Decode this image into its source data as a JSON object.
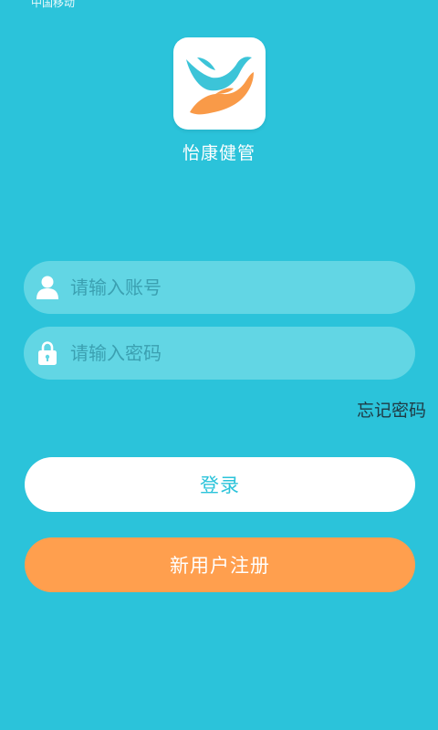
{
  "status_bar": {
    "carrier": "中国移动"
  },
  "app": {
    "name": "怡康健管"
  },
  "form": {
    "account_placeholder": "请输入账号",
    "password_placeholder": "请输入密码",
    "forgot_password": "忘记密码"
  },
  "buttons": {
    "login": "登录",
    "register": "新用户注册"
  },
  "icons": {
    "app_logo": "bird-hand-logo-icon",
    "account": "user-icon",
    "password": "lock-icon"
  },
  "colors": {
    "background": "#2BC3DA",
    "input_background": "#62D6E4",
    "login_button": "#FFFFFF",
    "register_button": "#FF9F4E",
    "logo_bird": "#3CC4D8",
    "logo_hand": "#F99A48"
  }
}
